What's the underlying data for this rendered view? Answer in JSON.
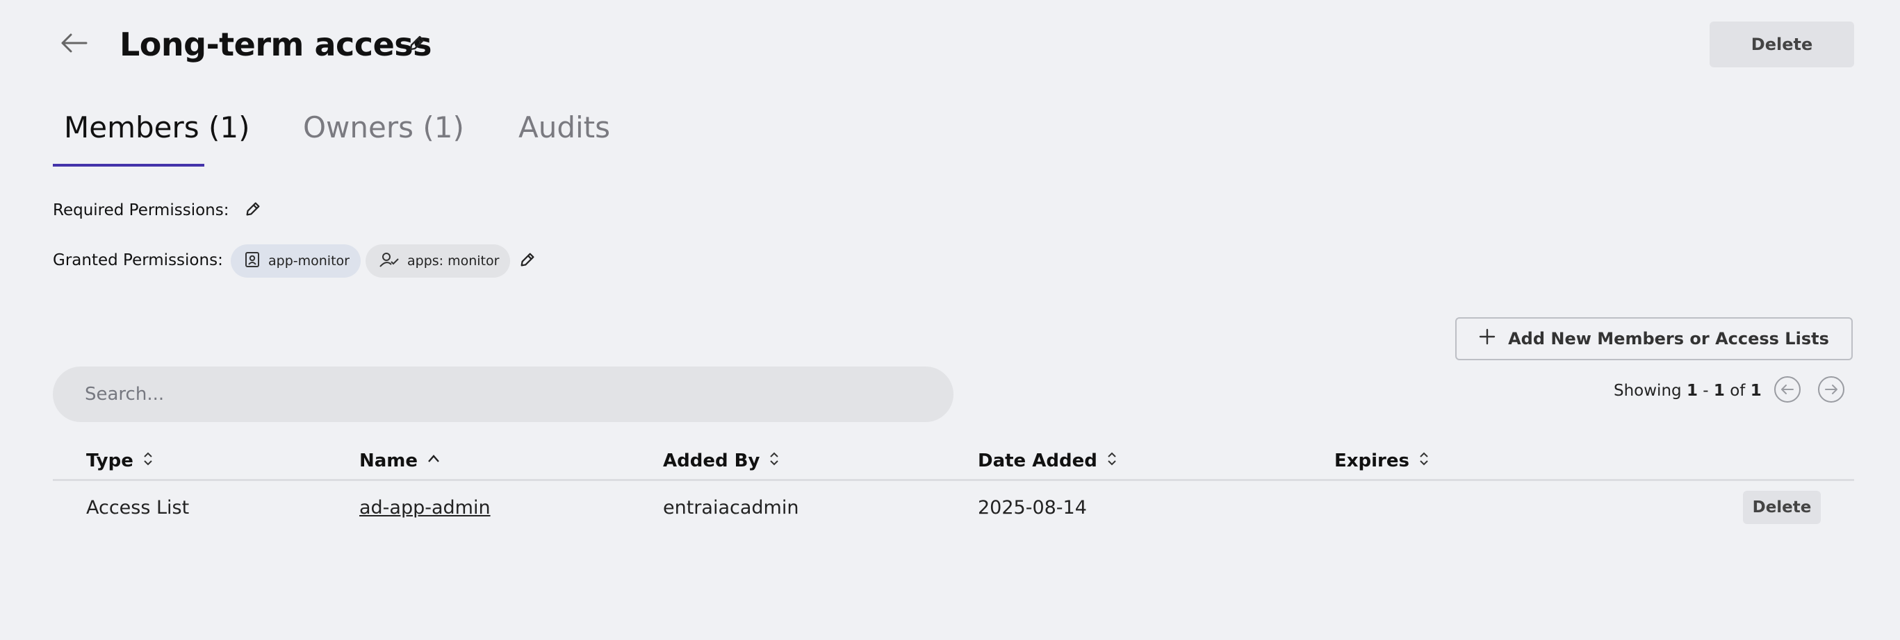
{
  "header": {
    "title": "Long-term access",
    "delete_label": "Delete"
  },
  "tabs": [
    {
      "label": "Members (1)",
      "active": true
    },
    {
      "label": "Owners (1)",
      "active": false
    },
    {
      "label": "Audits",
      "active": false
    }
  ],
  "permissions": {
    "required_label": "Required Permissions:",
    "granted_label": "Granted Permissions:",
    "granted_chips": [
      {
        "label": "app-monitor",
        "icon": "id-badge-icon"
      },
      {
        "label": "apps: monitor",
        "icon": "user-check-icon"
      }
    ]
  },
  "actions": {
    "add_label": "Add New Members or Access Lists"
  },
  "search": {
    "placeholder": "Search..."
  },
  "pagination": {
    "prefix": "Showing",
    "start": "1",
    "separator": "-",
    "end": "1",
    "of_label": "of",
    "total": "1"
  },
  "table": {
    "columns": [
      {
        "label": "Type",
        "sort": "none"
      },
      {
        "label": "Name",
        "sort": "ascending"
      },
      {
        "label": "Added By",
        "sort": "none"
      },
      {
        "label": "Date Added",
        "sort": "none"
      },
      {
        "label": "Expires",
        "sort": "none"
      }
    ],
    "rows": [
      {
        "type": "Access List",
        "name": "ad-app-admin",
        "added_by": "entraiacadmin",
        "date_added": "2025-08-14",
        "expires": "",
        "delete_label": "Delete"
      }
    ]
  },
  "colors": {
    "background": "#f0f1f4",
    "accent": "#4433aa",
    "chip_blue": "#dde2ec",
    "chip_gray": "#e2e3e6"
  }
}
